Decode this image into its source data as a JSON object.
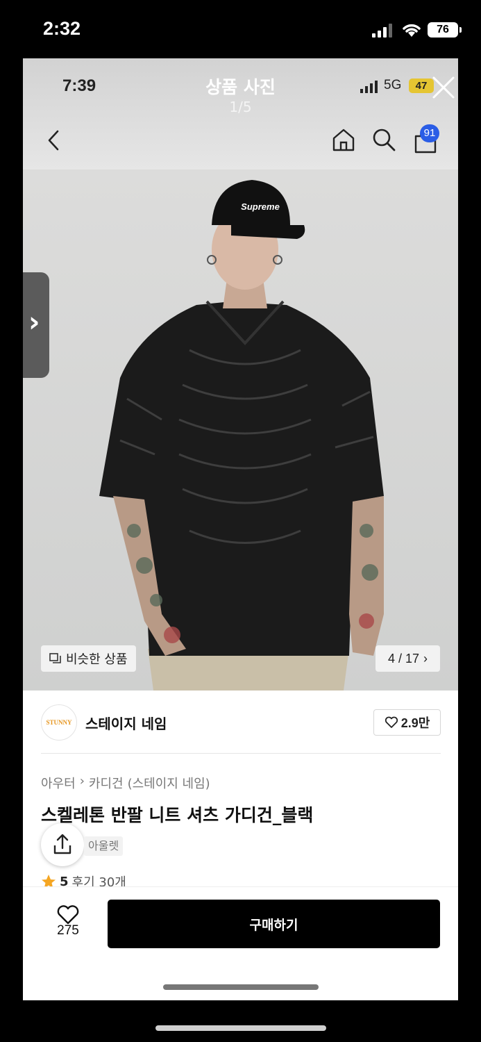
{
  "outer_status": {
    "time": "2:32",
    "battery": "76"
  },
  "viewer": {
    "time": "7:39",
    "title": "상품 사진",
    "counter": "1/5",
    "network": "5G",
    "battery": "47"
  },
  "header": {
    "cart_badge": "91"
  },
  "photo": {
    "similar_label": "비슷한 상품",
    "page_indicator": "4 / 17",
    "cap_text": "Supreme"
  },
  "store": {
    "logo_text": "STUNNY",
    "name": "스테이지 네임",
    "likes": "2.9만"
  },
  "breadcrumb": [
    "아우터",
    "카디건",
    "(스테이지 네임)"
  ],
  "product": {
    "title": "스켈레톤 반팔 니트 셔츠 가디건_블랙",
    "tag": "아울렛",
    "rating_score": "5",
    "reviews": "후기 30개"
  },
  "bottom_bar": {
    "wish_count": "275",
    "buy_label": "구매하기"
  },
  "colors": {
    "badge": "#2a5de6",
    "buy_button": "#000000",
    "battery_inner": "#e5c532",
    "star": "#f5a623"
  }
}
